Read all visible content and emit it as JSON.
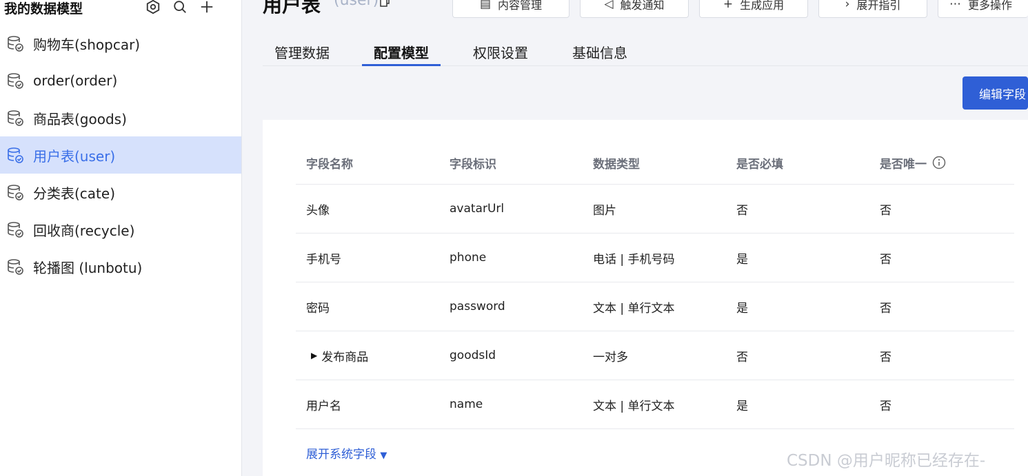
{
  "sidebar": {
    "title": "我的数据模型",
    "items": [
      {
        "label": "购物车(shopcar)"
      },
      {
        "label": "order(order)"
      },
      {
        "label": "商品表(goods)"
      },
      {
        "label": "用户表(user)"
      },
      {
        "label": "分类表(cate)"
      },
      {
        "label": "回收商(recycle)"
      },
      {
        "label": "轮播图 (lunbotu)"
      }
    ],
    "active_index": 3
  },
  "header": {
    "title": "用户表",
    "subtitle": "(user)",
    "buttons": [
      {
        "label": "内容管理"
      },
      {
        "label": "触发通知"
      },
      {
        "label": "生成应用"
      },
      {
        "label": "展开指引"
      },
      {
        "label": "更多操作"
      }
    ]
  },
  "tabs": [
    {
      "label": "管理数据"
    },
    {
      "label": "配置模型"
    },
    {
      "label": "权限设置"
    },
    {
      "label": "基础信息"
    }
  ],
  "active_tab": 1,
  "edit_button": "编辑字段",
  "table": {
    "columns": [
      "字段名称",
      "字段标识",
      "数据类型",
      "是否必填",
      "是否唯一"
    ],
    "rows": [
      {
        "name": "头像",
        "key": "avatarUrl",
        "type": "图片",
        "required": "否",
        "unique": "否"
      },
      {
        "name": "手机号",
        "key": "phone",
        "type": "电话 | 手机号码",
        "required": "是",
        "unique": "否"
      },
      {
        "name": "密码",
        "key": "password",
        "type": "文本 | 单行文本",
        "required": "是",
        "unique": "否"
      },
      {
        "name": "发布商品",
        "key": "goodsId",
        "type": "一对多",
        "required": "否",
        "unique": "否"
      },
      {
        "name": "用户名",
        "key": "name",
        "type": "文本 | 单行文本",
        "required": "是",
        "unique": "否"
      }
    ]
  },
  "expand_link": "展开系统字段",
  "watermark": "CSDN @用户昵称已经存在-",
  "colors": {
    "accent": "#2f5fd6",
    "active_bg": "#d6e1fc"
  }
}
